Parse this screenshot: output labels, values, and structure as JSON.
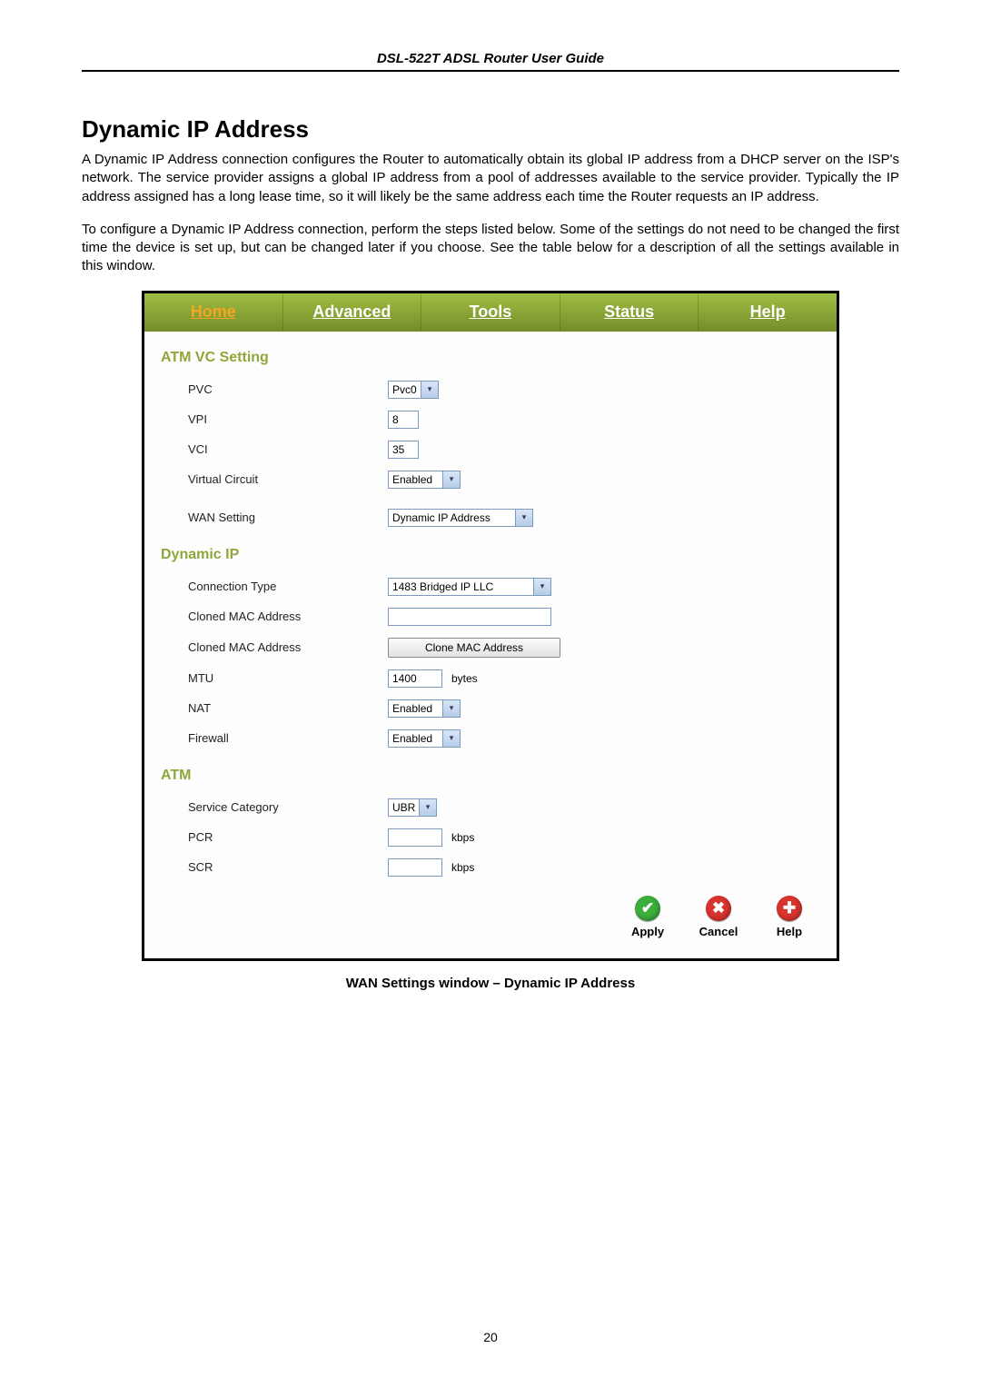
{
  "doc_header": "DSL-522T ADSL Router User Guide",
  "section_heading": "Dynamic IP Address",
  "para1": "A Dynamic IP Address connection configures the Router to automatically obtain its global IP address from a DHCP server on the ISP's network. The service provider assigns a global IP address from a pool of addresses available to the service provider. Typically the IP address assigned has a long lease time, so it will likely be the same address each time the Router requests an IP address.",
  "para2": "To configure a Dynamic IP Address connection, perform the steps listed below. Some of the settings do not need to be changed the first time the device is set up, but can be changed later if you choose. See the table below for a description of all the settings available in this window.",
  "tabs": {
    "home": "Home",
    "advanced": "Advanced",
    "tools": "Tools",
    "status": "Status",
    "help": "Help"
  },
  "sections": {
    "atm_vc": "ATM VC Setting",
    "dynamic_ip": "Dynamic IP",
    "atm": "ATM"
  },
  "form": {
    "pvc_label": "PVC",
    "pvc_value": "Pvc0",
    "vpi_label": "VPI",
    "vpi_value": "8",
    "vci_label": "VCI",
    "vci_value": "35",
    "vc_label": "Virtual Circuit",
    "vc_value": "Enabled",
    "wan_label": "WAN Setting",
    "wan_value": "Dynamic IP Address",
    "conn_type_label": "Connection Type",
    "conn_type_value": "1483 Bridged IP LLC",
    "cloned_mac_label": "Cloned MAC Address",
    "cloned_mac_value": "",
    "clone_btn_label": "Cloned MAC Address",
    "clone_btn": "Clone MAC Address",
    "mtu_label": "MTU",
    "mtu_value": "1400",
    "mtu_unit": "bytes",
    "nat_label": "NAT",
    "nat_value": "Enabled",
    "fw_label": "Firewall",
    "fw_value": "Enabled",
    "svc_cat_label": "Service Category",
    "svc_cat_value": "UBR",
    "pcr_label": "PCR",
    "pcr_value": "",
    "pcr_unit": "kbps",
    "scr_label": "SCR",
    "scr_value": "",
    "scr_unit": "kbps"
  },
  "actions": {
    "apply": "Apply",
    "cancel": "Cancel",
    "help": "Help"
  },
  "caption": "WAN Settings window – Dynamic IP Address",
  "page_number": "20"
}
